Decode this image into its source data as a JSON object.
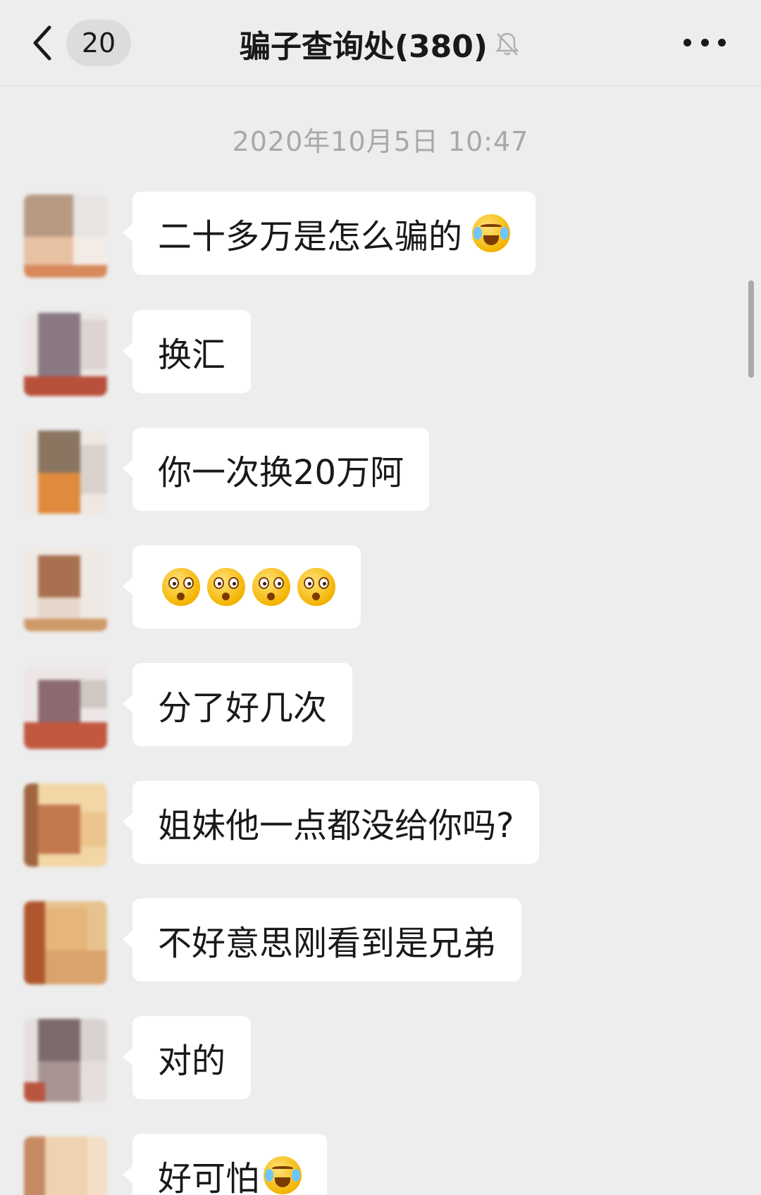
{
  "header": {
    "unread_count": "20",
    "title": "骗子查询处(380)"
  },
  "timestamp": "2020年10月5日 10:47",
  "messages": [
    {
      "text": "二十多万是怎么骗的",
      "emoji": "cry-icon"
    },
    {
      "text": "换汇"
    },
    {
      "text": "你一次换20万阿"
    },
    {
      "text": "",
      "emoji_count": 4,
      "emoji": "shocked-face-icon"
    },
    {
      "text": "分了好几次"
    },
    {
      "text": "姐妹他一点都没给你吗?"
    },
    {
      "text": "不好意思刚看到是兄弟"
    },
    {
      "text": "对的"
    },
    {
      "text": "好可怕",
      "emoji": "cry-icon"
    }
  ],
  "colors": {
    "background": "#ededed",
    "bubble": "#ffffff",
    "text": "#191919",
    "timestamp": "#a8a8a8"
  }
}
